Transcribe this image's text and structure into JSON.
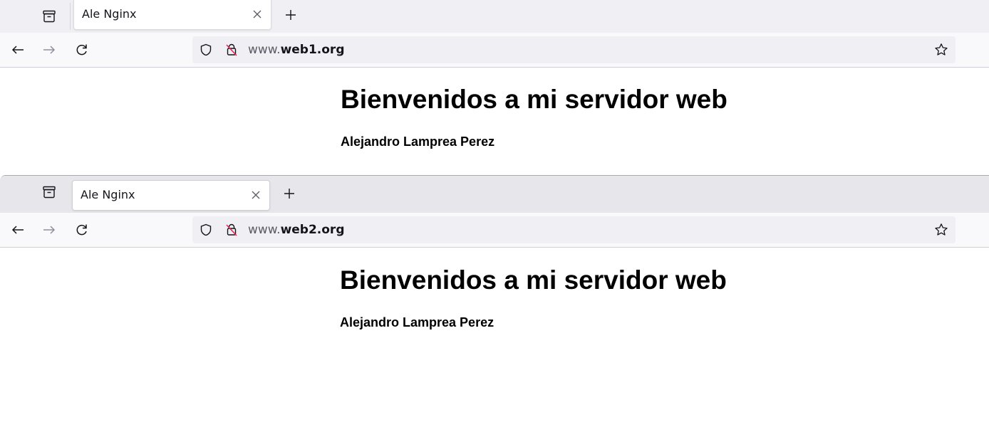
{
  "windows": [
    {
      "tab": {
        "title": "Ale Nginx"
      },
      "url": {
        "prefix": "www.",
        "domain": "web1.org"
      },
      "page": {
        "heading": "Bienvenidos a mi servidor web",
        "author": "Alejandro Lamprea Perez"
      }
    },
    {
      "tab": {
        "title": "Ale Nginx"
      },
      "url": {
        "prefix": "www.",
        "domain": "web2.org"
      },
      "page": {
        "heading": "Bienvenidos a mi servidor web",
        "author": "Alejandro Lamprea Perez"
      }
    }
  ],
  "icons": {
    "tab_list": "archive-box-icon",
    "close": "close-icon",
    "new_tab": "plus-icon",
    "back": "arrow-left-icon",
    "forward": "arrow-right-icon",
    "reload": "reload-icon",
    "tracking": "shield-icon",
    "insecure": "lock-strikethrough-icon",
    "bookmark": "star-outline-icon"
  },
  "colors": {
    "insecure_strike": "#e22850",
    "tab_bar": "#f0f0f4",
    "url_bar": "#f0f0f4"
  }
}
